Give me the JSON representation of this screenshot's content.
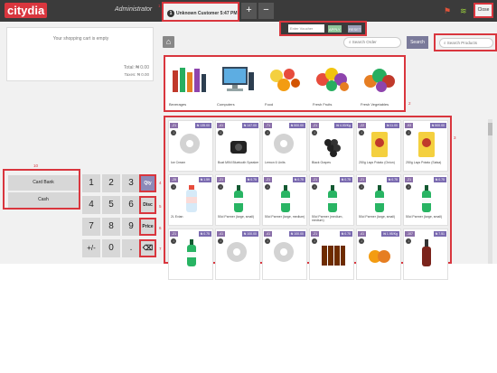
{
  "topbar": {
    "logo": "citydia",
    "user": "Administrator",
    "tab_number": "1",
    "tab_label": "Unknown Customer 5:47 PM",
    "add_tab": "+",
    "remove_tab": "−",
    "close_label": "Close"
  },
  "voucher": {
    "placeholder": "Enter Voucher",
    "apply": "APPLY",
    "reset": "RESET"
  },
  "cart": {
    "empty_text": "Your shopping cart is empty",
    "total": "Total: ₦ 0.00",
    "taxes": "Taxes: ₦ 0.00"
  },
  "search": {
    "order_placeholder": "Search Order",
    "button": "Search",
    "products_placeholder": "Search Products"
  },
  "categories": [
    {
      "label": "Beverages"
    },
    {
      "label": "Computers"
    },
    {
      "label": "Food"
    },
    {
      "label": "Fresh Fruits"
    },
    {
      "label": "Fresh Vegetables"
    }
  ],
  "products": [
    {
      "discount": "-21",
      "price": "₦ 135.00",
      "name": "Ice Cream"
    },
    {
      "discount": "-41",
      "price": "₦ 147.00",
      "name": "Boat MINI Bluetooth Speaker"
    },
    {
      "discount": "-71",
      "price": "₦ 500.00",
      "name": "Lemon 6 Units"
    },
    {
      "discount": "-21",
      "price": "₦ 4.00/Kg",
      "name": "Black Grapes"
    },
    {
      "discount": "-22",
      "price": "₦ 11.00",
      "name": "250g Lays Potato (Onion)"
    },
    {
      "discount": "-53",
      "price": "₦ 500.00",
      "name": "250g Lays Potato (Salsa)"
    },
    {
      "discount": "-25",
      "price": "₦ 1.59",
      "name": "2L Evian"
    },
    {
      "discount": "-21",
      "price": "₦ 0.75",
      "name": "50cl Parmer (large, small)"
    },
    {
      "discount": "-21",
      "price": "₦ 0.75",
      "name": "50cl Parmer (large, medium)"
    },
    {
      "discount": "-21",
      "price": "₦ 0.75",
      "name": "50cl Parmer (medium, medium)"
    },
    {
      "discount": "-21",
      "price": "₦ 0.75",
      "name": "50cl Parmer (large, small)"
    },
    {
      "discount": "-21",
      "price": "₦ 0.75",
      "name": "50cl Parmer (large, small)"
    },
    {
      "discount": "-21",
      "price": "₦ 0.75",
      "name": ""
    },
    {
      "discount": "-41",
      "price": "₦ 100.00",
      "name": ""
    },
    {
      "discount": "-41",
      "price": "₦ 100.00",
      "name": ""
    },
    {
      "discount": "-21",
      "price": "₦ 0.75",
      "name": ""
    },
    {
      "discount": "-41",
      "price": "₦ 1.95/Kg",
      "name": ""
    },
    {
      "discount": "-107",
      "price": "₦ 7.51",
      "name": ""
    }
  ],
  "payments": {
    "card": "Card Bank",
    "cash": "Cash"
  },
  "numpad": {
    "keys": [
      "1",
      "2",
      "3",
      "4",
      "5",
      "6",
      "7",
      "8",
      "9",
      "+/-",
      "0",
      "."
    ],
    "qty": "Qty",
    "disc": "Disc",
    "price": "Price",
    "backspace": "⌫"
  },
  "markers": [
    "1",
    "2",
    "3",
    "4",
    "5",
    "6",
    "7",
    "10"
  ],
  "colors": {
    "accent": "#d9363e",
    "topbar": "#3b3b3b",
    "active_fn": "#8c8ab8"
  }
}
